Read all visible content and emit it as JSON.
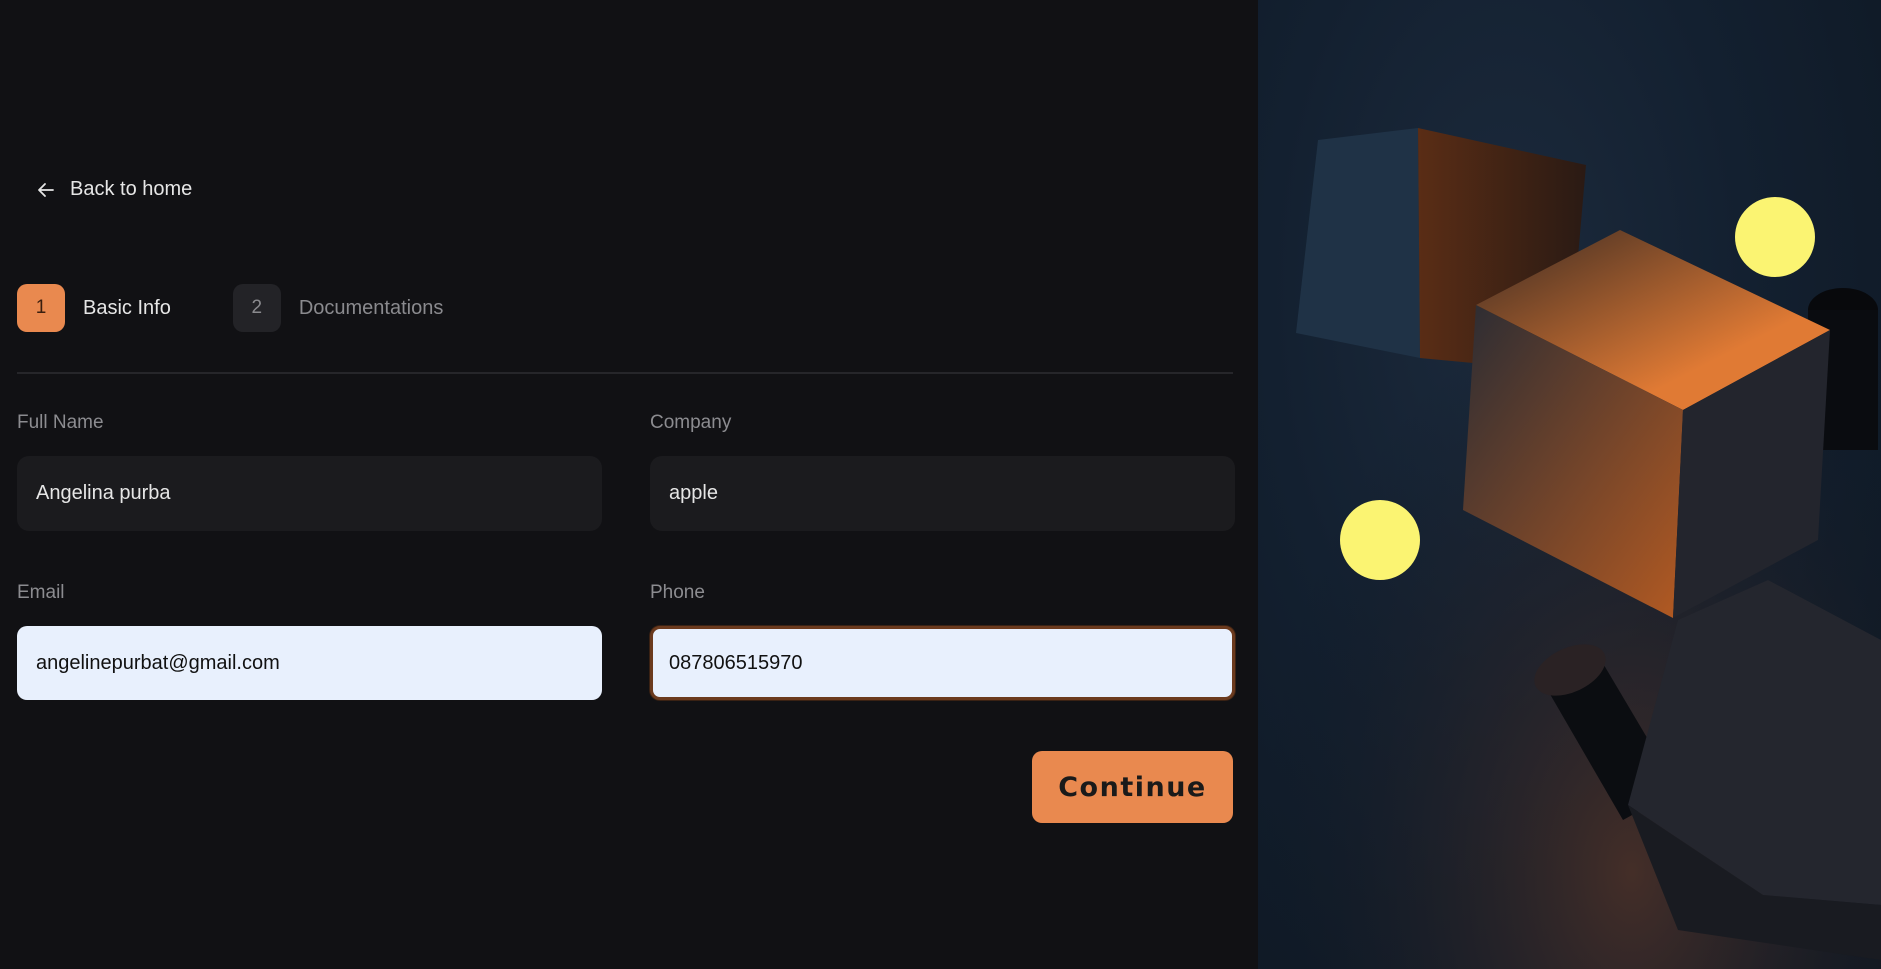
{
  "nav": {
    "back_label": "Back to home"
  },
  "steps": [
    {
      "number": "1",
      "label": "Basic Info",
      "active": true
    },
    {
      "number": "2",
      "label": "Documentations",
      "active": false
    }
  ],
  "form": {
    "full_name": {
      "label": "Full Name",
      "value": "Angelina purba"
    },
    "company": {
      "label": "Company",
      "value": "apple"
    },
    "email": {
      "label": "Email",
      "value": "angelinepurbat@gmail.com"
    },
    "phone": {
      "label": "Phone",
      "value": "087806515970"
    }
  },
  "actions": {
    "continue_label": "Continue"
  },
  "colors": {
    "accent": "#e9894f",
    "background": "#111114",
    "input_dark": "#1b1b1e",
    "input_autofill": "#e8f0fd",
    "sphere": "#fbf472"
  }
}
